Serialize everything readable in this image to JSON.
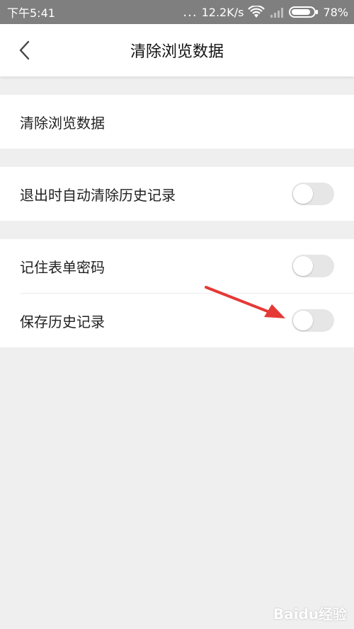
{
  "status_bar": {
    "time": "下午5:41",
    "dots": "...",
    "speed": "12.2K/s",
    "battery": "78%"
  },
  "header": {
    "title": "清除浏览数据"
  },
  "settings": {
    "clear_data_label": "清除浏览数据",
    "auto_clear_label": "退出时自动清除历史记录",
    "auto_clear_on": false,
    "remember_password_label": "记住表单密码",
    "remember_password_on": false,
    "save_history_label": "保存历史记录",
    "save_history_on": false
  },
  "watermark": "Baidu经验",
  "colors": {
    "status_bar_bg": "#7f7f7f",
    "page_bg": "#efefef",
    "toggle_off": "#e6e6e6",
    "annotation_arrow": "#e53935"
  }
}
